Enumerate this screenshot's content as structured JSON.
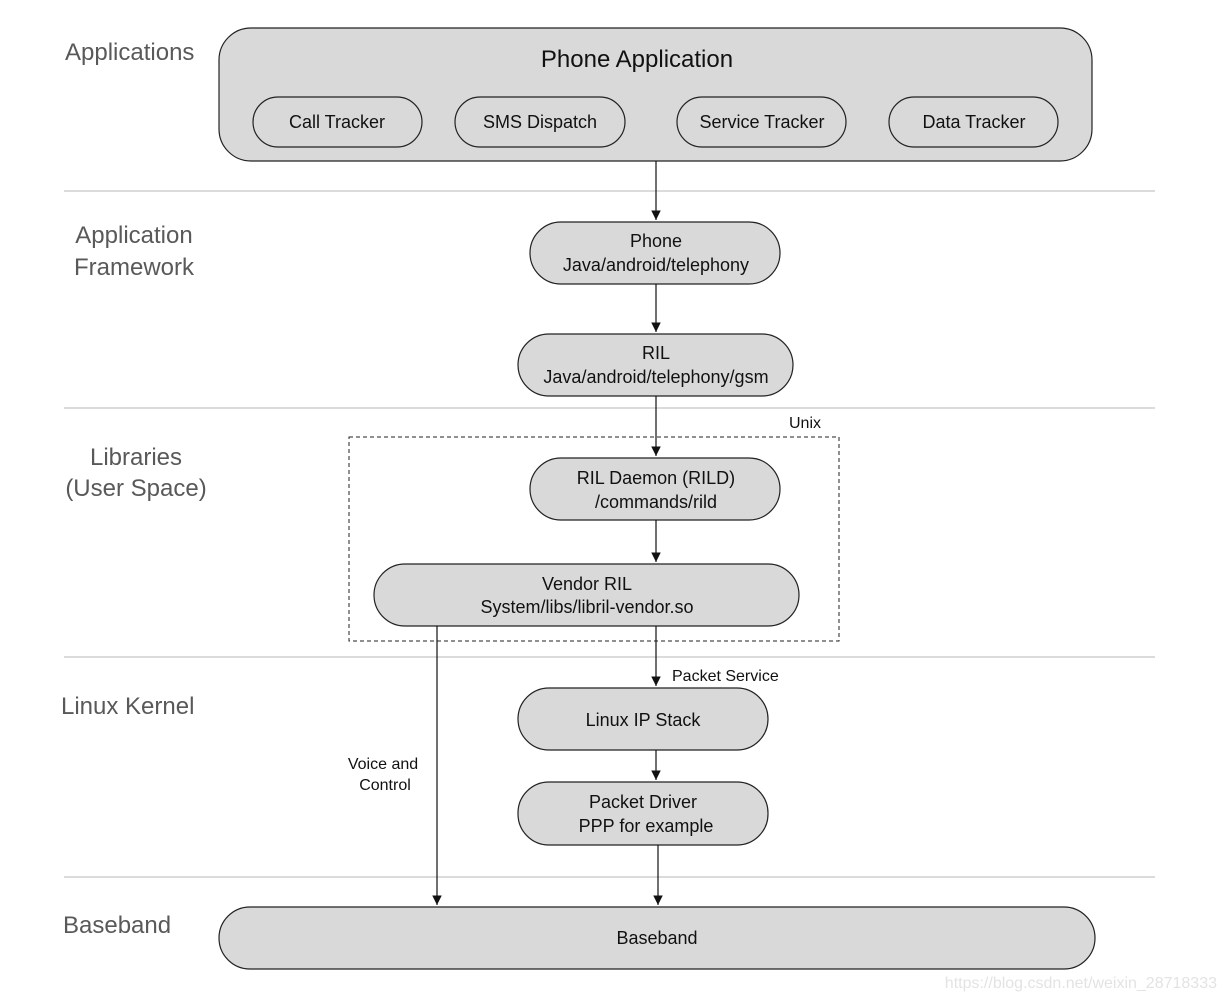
{
  "layers": {
    "applications": "Applications",
    "framework": [
      "Application",
      "Framework"
    ],
    "libraries": [
      "Libraries",
      "(User Space)"
    ],
    "kernel": "Linux Kernel",
    "baseband": "Baseband"
  },
  "nodes": {
    "phone_app": {
      "title": "Phone Application",
      "items": [
        "Call Tracker",
        "SMS Dispatch",
        "Service Tracker",
        "Data Tracker"
      ]
    },
    "phone": [
      "Phone",
      "Java/android/telephony"
    ],
    "ril": [
      "RIL",
      "Java/android/telephony/gsm"
    ],
    "rild": [
      "RIL Daemon (RILD)",
      "/commands/rild"
    ],
    "vendor_ril": [
      "Vendor RIL",
      "System/libs/libril-vendor.so"
    ],
    "ip_stack": "Linux IP Stack",
    "packet_driver": [
      "Packet Driver",
      "PPP for example"
    ],
    "baseband": "Baseband"
  },
  "edge_labels": {
    "unix": "Unix",
    "packet_service": "Packet Service",
    "voice": [
      "Voice and",
      "Control"
    ]
  },
  "watermark": "https://blog.csdn.net/weixin_28718333",
  "colors": {
    "node_fill": "#d9d9d9",
    "layer_text": "#595959"
  }
}
